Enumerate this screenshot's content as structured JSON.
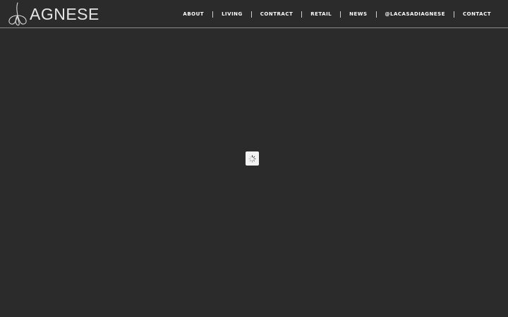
{
  "brand": {
    "name": "AGNESE",
    "logo_icon": "trefoil-logo-icon"
  },
  "nav": {
    "items": [
      {
        "label": "ABOUT"
      },
      {
        "label": "LIVING"
      },
      {
        "label": "CONTRACT"
      },
      {
        "label": "RETAIL"
      },
      {
        "label": "NEWS"
      },
      {
        "label": "@LACASADIAGNESE"
      },
      {
        "label": "CONTACT"
      }
    ]
  },
  "loader": {
    "icon": "loading-spinner-icon"
  },
  "colors": {
    "background": "#2b2b2b",
    "header_rule": "#8a8a8a",
    "nav_text": "#ffffff",
    "loader_bg": "#f2f2f2"
  }
}
